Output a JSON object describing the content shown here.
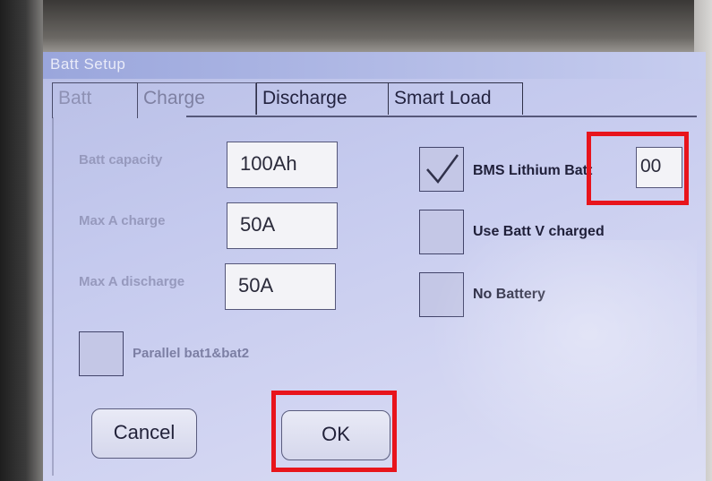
{
  "window": {
    "title": "Batt Setup"
  },
  "tabs": [
    {
      "label": "Batt",
      "state": "active"
    },
    {
      "label": "Charge",
      "state": "inactive"
    },
    {
      "label": "Discharge",
      "state": "normal"
    },
    {
      "label": "Smart Load",
      "state": "normal"
    }
  ],
  "fields": {
    "capacity": {
      "label": "Batt capacity",
      "value": "100Ah"
    },
    "max_charge": {
      "label": "Max A charge",
      "value": "50A"
    },
    "max_discharge": {
      "label": "Max A discharge",
      "value": "50A"
    },
    "bms_batt": {
      "value": "00"
    }
  },
  "checkboxes": {
    "bms_lithium": {
      "label": "BMS Lithium Batt",
      "checked": true
    },
    "use_batt_v": {
      "label": "Use Batt V charged",
      "checked": false
    },
    "no_battery": {
      "label": "No Battery",
      "checked": false
    },
    "parallel": {
      "label": "Parallel bat1&bat2",
      "checked": false
    }
  },
  "buttons": {
    "cancel": "Cancel",
    "ok": "OK"
  },
  "colors": {
    "highlight": "#e8141c",
    "screen_bg": "#c5caee"
  }
}
